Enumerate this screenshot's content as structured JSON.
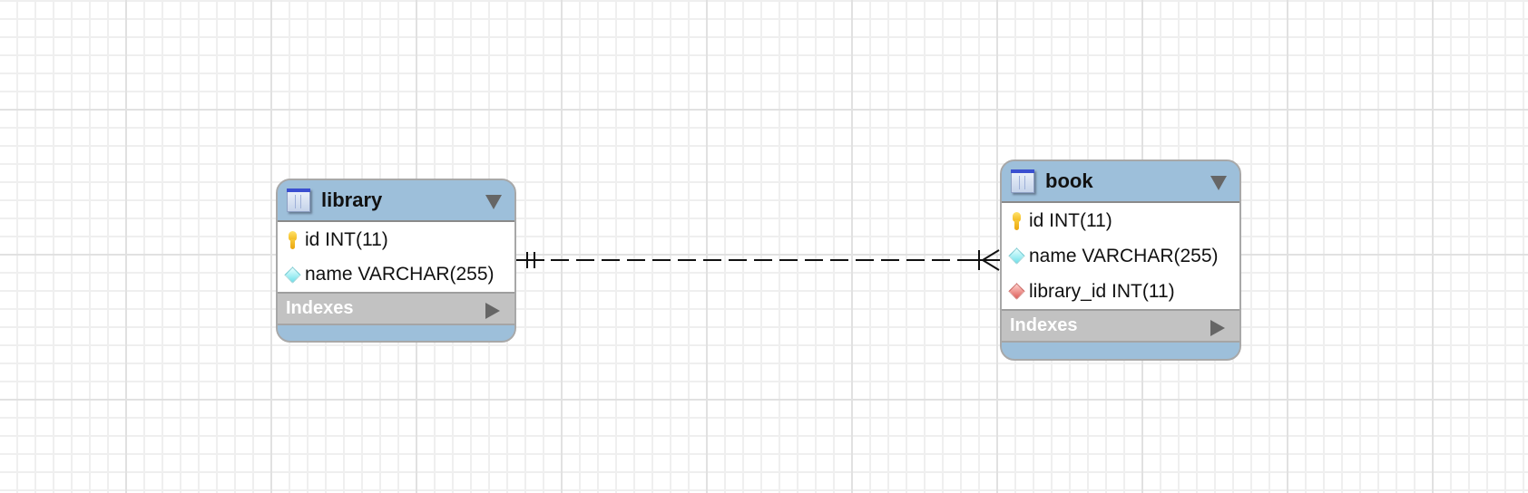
{
  "diagram": {
    "tables": [
      {
        "name": "library",
        "columns": [
          {
            "label": "id INT(11)",
            "icon": "primary-key-icon"
          },
          {
            "label": "name VARCHAR(255)",
            "icon": "column-diamond-icon"
          }
        ],
        "indexes_label": "Indexes"
      },
      {
        "name": "book",
        "columns": [
          {
            "label": "id INT(11)",
            "icon": "primary-key-icon"
          },
          {
            "label": "name VARCHAR(255)",
            "icon": "column-diamond-icon"
          },
          {
            "label": "library_id INT(11)",
            "icon": "foreign-key-diamond-icon"
          }
        ],
        "indexes_label": "Indexes"
      }
    ],
    "relationships": [
      {
        "from": "library",
        "to": "book",
        "from_cardinality": "one-and-only-one",
        "to_cardinality": "one-or-many",
        "style": "dashed",
        "identifying": false
      }
    ],
    "colors": {
      "table_header": "#9dbfda",
      "indexes_bar": "#c2c2c2",
      "primary_key": "#f2b618",
      "column": "#6fe0ea",
      "foreign_key": "#de5f5a"
    }
  }
}
